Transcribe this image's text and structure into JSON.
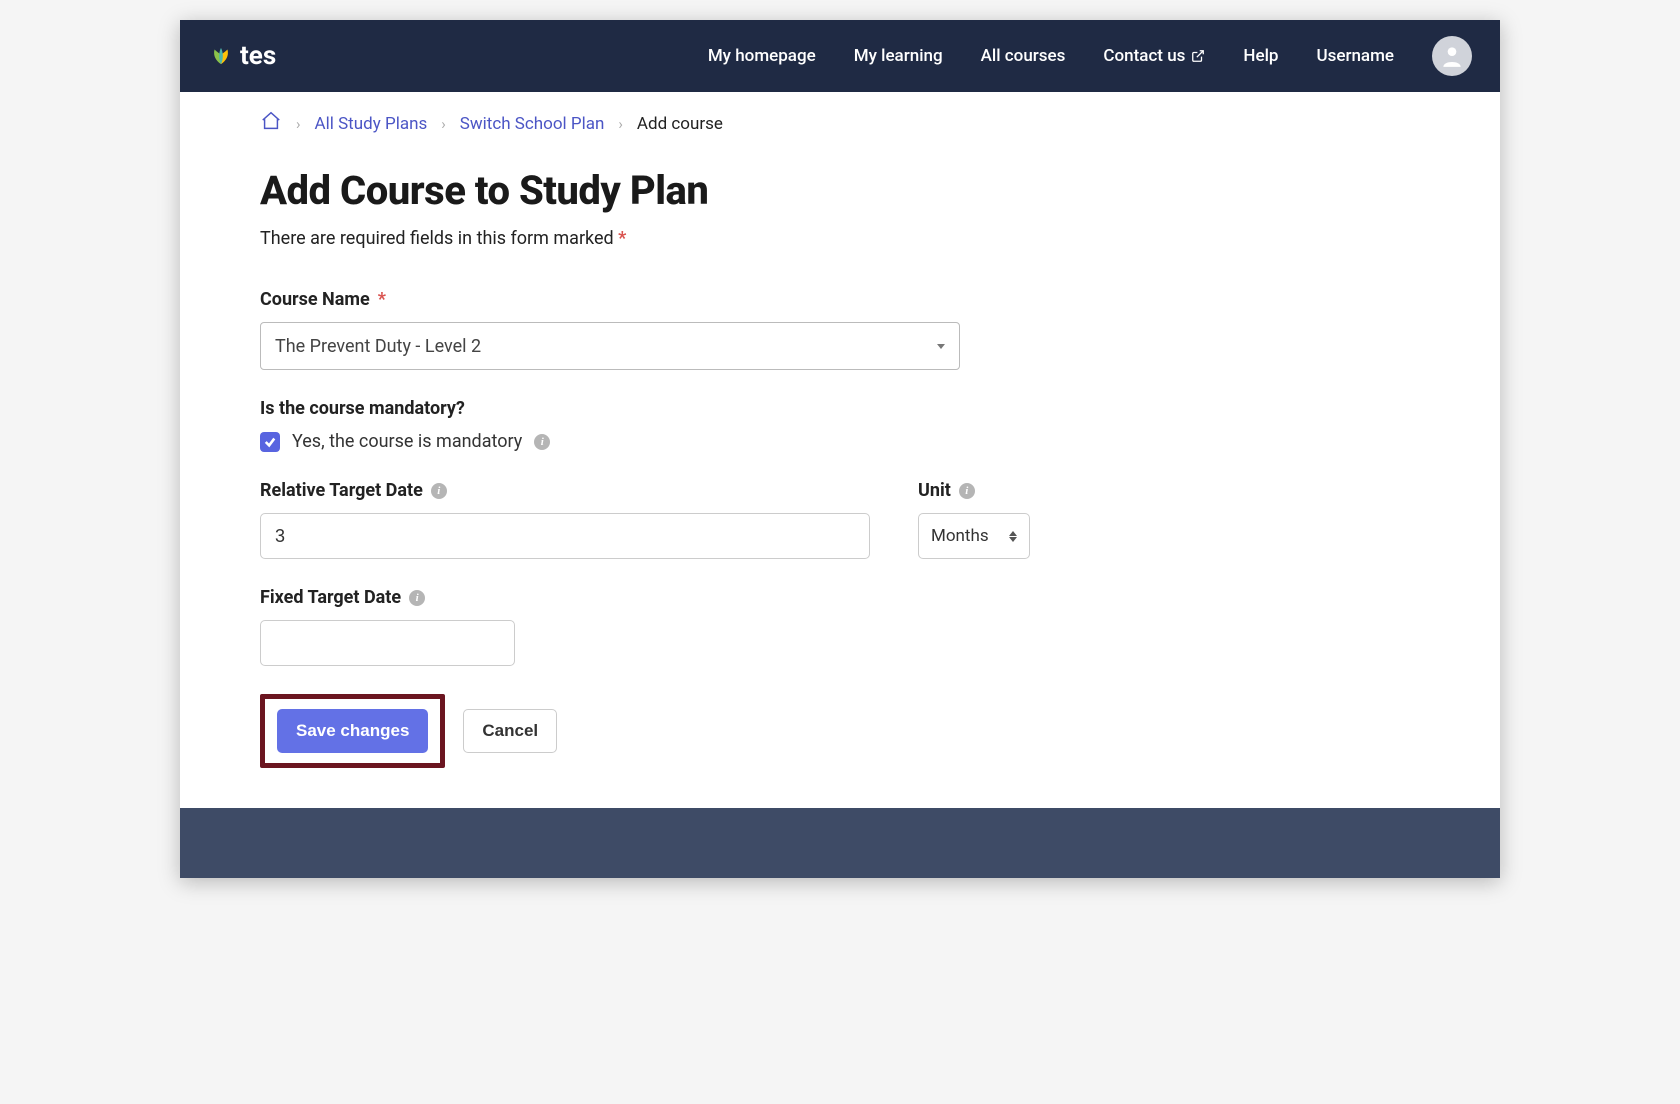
{
  "header": {
    "logo_text": "tes",
    "nav": {
      "homepage": "My homepage",
      "learning": "My learning",
      "courses": "All courses",
      "contact": "Contact us",
      "help": "Help",
      "username": "Username"
    }
  },
  "breadcrumb": {
    "all_plans": "All Study Plans",
    "switch_plan": "Switch School Plan",
    "current": "Add course"
  },
  "page": {
    "title": "Add Course to Study Plan",
    "required_note": "There are required fields in this form marked",
    "required_symbol": "*"
  },
  "form": {
    "course_name": {
      "label": "Course Name",
      "value": "The Prevent Duty - Level 2"
    },
    "mandatory": {
      "label": "Is the course mandatory?",
      "checkbox_label": "Yes, the course is mandatory",
      "checked": true
    },
    "relative_date": {
      "label": "Relative Target Date",
      "value": "3"
    },
    "unit": {
      "label": "Unit",
      "value": "Months"
    },
    "fixed_date": {
      "label": "Fixed Target Date",
      "value": ""
    },
    "buttons": {
      "save": "Save changes",
      "cancel": "Cancel"
    }
  }
}
